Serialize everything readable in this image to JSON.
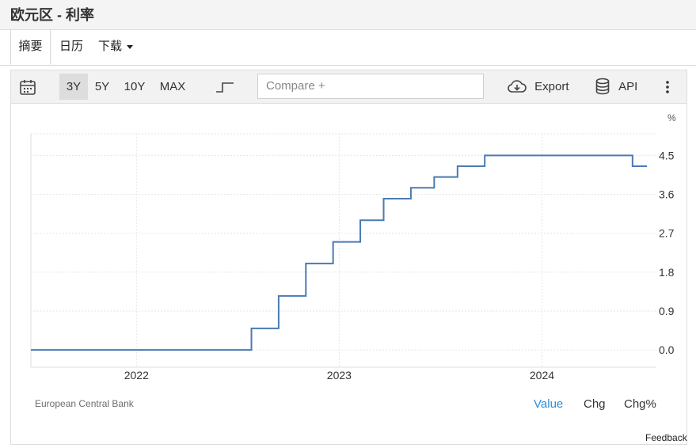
{
  "page": {
    "title": "欧元区 - 利率",
    "tabs": [
      {
        "label": "摘要",
        "active": true
      },
      {
        "label": "日历",
        "active": false
      },
      {
        "label": "下载",
        "active": false
      }
    ]
  },
  "toolbar": {
    "ranges": [
      "3Y",
      "5Y",
      "10Y",
      "MAX"
    ],
    "active_range": "3Y",
    "compare_placeholder": "Compare +",
    "export_label": "Export",
    "api_label": "API",
    "icons": [
      "calendar-icon",
      "step-line-icon",
      "cloud-download-icon",
      "database-icon",
      "more-vertical-icon"
    ]
  },
  "chart_data": {
    "type": "line",
    "step": true,
    "unit": "%",
    "x_ticks": [
      "2022",
      "2023",
      "2024"
    ],
    "y_ticks": [
      0.0,
      0.9,
      1.8,
      2.7,
      3.6,
      4.5
    ],
    "y_tick_labels": [
      "0.0",
      "0.9",
      "1.8",
      "2.7",
      "3.6",
      "4.5"
    ],
    "ylim": [
      -0.4,
      5.0
    ],
    "xlim": [
      "2021-06-25",
      "2024-07-25"
    ],
    "series": [
      {
        "color": "#4a7ab5",
        "x": [
          "2021-06-25",
          "2022-07-27",
          "2022-09-14",
          "2022-11-02",
          "2022-12-21",
          "2023-02-08",
          "2023-03-22",
          "2023-05-10",
          "2023-06-21",
          "2023-08-02",
          "2023-09-20",
          "2024-06-12",
          "2024-06-12"
        ],
        "y": [
          0.0,
          0.5,
          1.25,
          2.0,
          2.5,
          3.0,
          3.5,
          3.75,
          4.0,
          4.25,
          4.5,
          4.5,
          4.25
        ]
      }
    ],
    "grid": true,
    "legend": "none"
  },
  "footer": {
    "source": "European Central Bank",
    "value_modes": [
      "Value",
      "Chg",
      "Chg%"
    ],
    "active_mode": "Value",
    "feedback_label": "Feedback"
  },
  "colors": {
    "accent": "#2d8ddc",
    "line": "#4a7ab5",
    "grid": "#e6e6e6"
  }
}
